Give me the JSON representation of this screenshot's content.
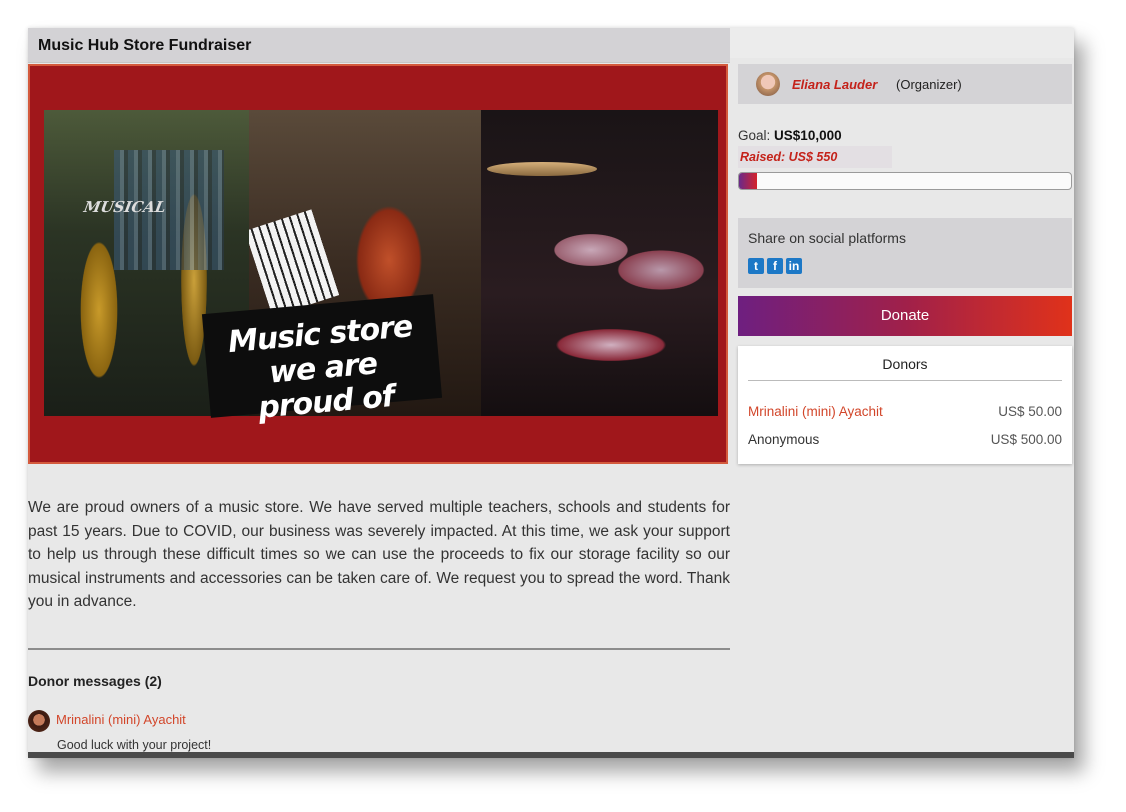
{
  "page": {
    "title": "Music Hub Store Fundraiser"
  },
  "hero": {
    "caption_line1": "Music store we are",
    "caption_line2": "proud of",
    "shop_sign": "MUSICAL"
  },
  "description": "We are proud owners of a music store. We have served multiple teachers, schools and students for past 15 years. Due to COVID, our business was severely impacted.  At this time, we ask your support to help us through these difficult times so we can use the proceeds to fix our storage facility so our musical instruments and accessories can be taken care of. We request you to spread the word. Thank you in advance.",
  "messages": {
    "title": "Donor messages (2)",
    "items": [
      {
        "name": "Mrinalini (mini) Ayachit",
        "text": "Good luck with your project!"
      }
    ]
  },
  "organizer": {
    "name": "Eliana Lauder",
    "role": "(Organizer)"
  },
  "goal": {
    "label": "Goal:",
    "amount": "US$10,000",
    "raised": "Raised: US$ 550",
    "progress_fraction": 0.055
  },
  "share": {
    "label": "Share on social platforms",
    "icons": [
      "twitter-icon",
      "facebook-icon",
      "linkedin-icon"
    ],
    "twitter": "t",
    "facebook": "f",
    "linkedin": "in"
  },
  "donate": {
    "label": "Donate"
  },
  "donors": {
    "title": "Donors",
    "rows": [
      {
        "name": "Mrinalini (mini) Ayachit",
        "amount": "US$ 50.00"
      },
      {
        "name": "Anonymous",
        "amount": "US$ 500.00"
      }
    ]
  },
  "colors": {
    "accent_red": "#c4221a",
    "donate_gradient_start": "#6e1f80",
    "donate_gradient_end": "#e0321a",
    "hero_background": "#a0171b"
  }
}
